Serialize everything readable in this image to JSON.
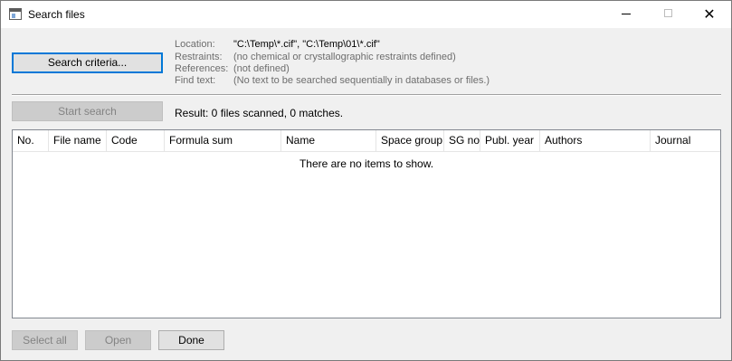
{
  "window": {
    "title": "Search files"
  },
  "titlebar_icons": {
    "minimize": "minimize-icon",
    "maximize": "maximize-icon",
    "close": "close-icon"
  },
  "search_criteria_button": {
    "label": "Search criteria..."
  },
  "info": {
    "location_label": "Location:",
    "location_value": "\"C:\\Temp\\*.cif\", \"C:\\Temp\\01\\*.cif\"",
    "restraints_label": "Restraints:",
    "restraints_value": "(no chemical or crystallographic restraints defined)",
    "references_label": "References:",
    "references_value": "(not defined)",
    "findtext_label": "Find text:",
    "findtext_value": "(No text to be searched sequentially in databases or files.)"
  },
  "start_search_button": {
    "label": "Start search"
  },
  "result_text": "Result: 0 files scanned, 0 matches.",
  "table": {
    "columns": [
      "No.",
      "File name",
      "Code",
      "Formula sum",
      "Name",
      "Space group",
      "SG no.",
      "Publ. year",
      "Authors",
      "Journal"
    ],
    "empty_message": "There are no items to show."
  },
  "footer": {
    "select_all_label": "Select all",
    "open_label": "Open",
    "done_label": "Done"
  }
}
